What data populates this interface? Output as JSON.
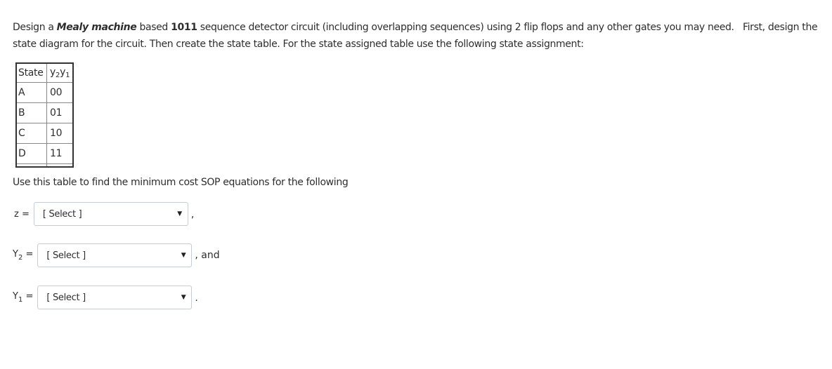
{
  "question": {
    "line1_prefix": "Design a ",
    "line1_em": "Mealy machine",
    "line1_mid": " based ",
    "line1_strong": "1011",
    "line1_suffix": " sequence detector circuit (including overlapping sequences) using 2 flip flops and any other gates you may need.   First, design the",
    "line2": "state diagram for the circuit. Then create the state table. For the state assigned table use the following state assignment:"
  },
  "state_table": {
    "header_state": "State",
    "header_y2": "y",
    "header_y2_sub": "2",
    "header_y1": "y",
    "header_y1_sub": "1",
    "rows": [
      {
        "state": "A",
        "code": "00"
      },
      {
        "state": "B",
        "code": "01"
      },
      {
        "state": "C",
        "code": "10"
      },
      {
        "state": "D",
        "code": "11"
      }
    ]
  },
  "instruction": "Use this table to find the minimum cost SOP equations for the following",
  "equations": [
    {
      "label": "z",
      "label_sub": "",
      "equals": " =",
      "select_value": "[ Select ]",
      "suffix": ","
    },
    {
      "label": "Y",
      "label_sub": "2",
      "equals": " =",
      "select_value": "[ Select ]",
      "suffix": ", and"
    },
    {
      "label": "Y",
      "label_sub": "1",
      "equals": " =",
      "select_value": "[ Select ]",
      "suffix": "."
    }
  ],
  "icons": {
    "caret": "▼"
  }
}
